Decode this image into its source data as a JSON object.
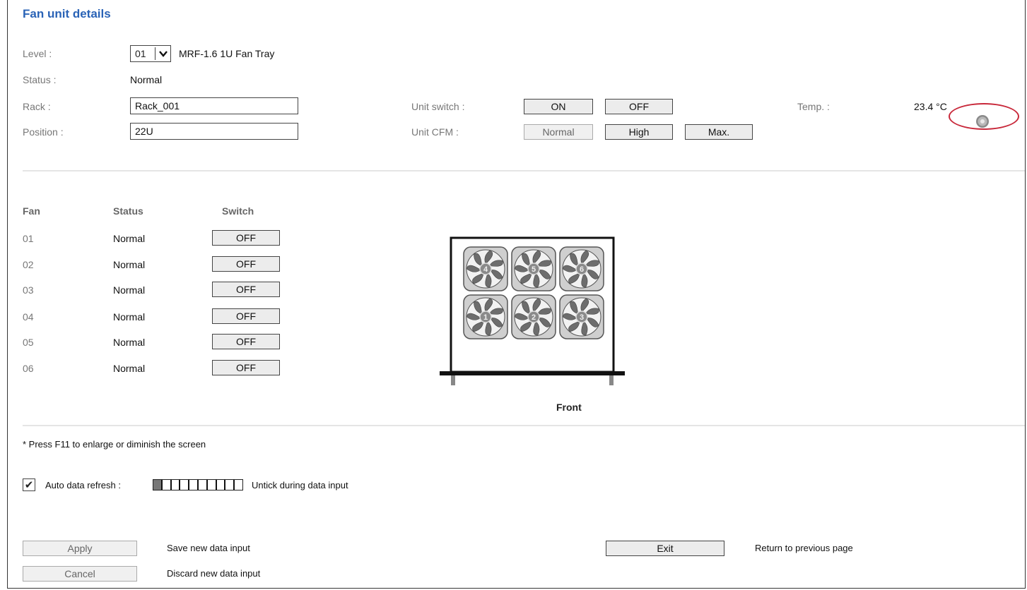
{
  "page": {
    "title": "Fan unit details"
  },
  "unit": {
    "level_label": "Level :",
    "level_value": "01",
    "model": "MRF-1.6 1U Fan Tray",
    "status_label": "Status :",
    "status_value": "Normal",
    "rack_label": "Rack :",
    "rack_value": "Rack_001",
    "position_label": "Position :",
    "position_value": "22U",
    "switch_label": "Unit switch :",
    "switch_on": "ON",
    "switch_off": "OFF",
    "cfm_label": "Unit CFM :",
    "cfm_normal": "Normal",
    "cfm_high": "High",
    "cfm_max": "Max.",
    "temp_label": "Temp. :",
    "temp_value": "23.4 °C",
    "settings_icon": "gear-icon"
  },
  "fans": {
    "headers": {
      "fan": "Fan",
      "status": "Status",
      "switch": "Switch"
    },
    "rows": [
      {
        "id": "01",
        "status": "Normal",
        "switch": "OFF"
      },
      {
        "id": "02",
        "status": "Normal",
        "switch": "OFF"
      },
      {
        "id": "03",
        "status": "Normal",
        "switch": "OFF"
      },
      {
        "id": "04",
        "status": "Normal",
        "switch": "OFF"
      },
      {
        "id": "05",
        "status": "Normal",
        "switch": "OFF"
      },
      {
        "id": "06",
        "status": "Normal",
        "switch": "OFF"
      }
    ],
    "diagram_top_row": [
      "4",
      "5",
      "6"
    ],
    "diagram_bottom_row": [
      "1",
      "2",
      "3"
    ],
    "diagram_caption": "Front"
  },
  "footer": {
    "note": "* Press F11 to enlarge or diminish the screen",
    "auto_refresh_label": "Auto data refresh :",
    "auto_refresh_checked": true,
    "refresh_segments": 10,
    "refresh_filled": 1,
    "refresh_hint": "Untick during data input",
    "apply": "Apply",
    "apply_desc": "Save new data input",
    "cancel": "Cancel",
    "cancel_desc": "Discard new data input",
    "exit": "Exit",
    "exit_desc": "Return to previous page"
  },
  "colors": {
    "title": "#2a63b6",
    "highlight": "#c8283a"
  }
}
